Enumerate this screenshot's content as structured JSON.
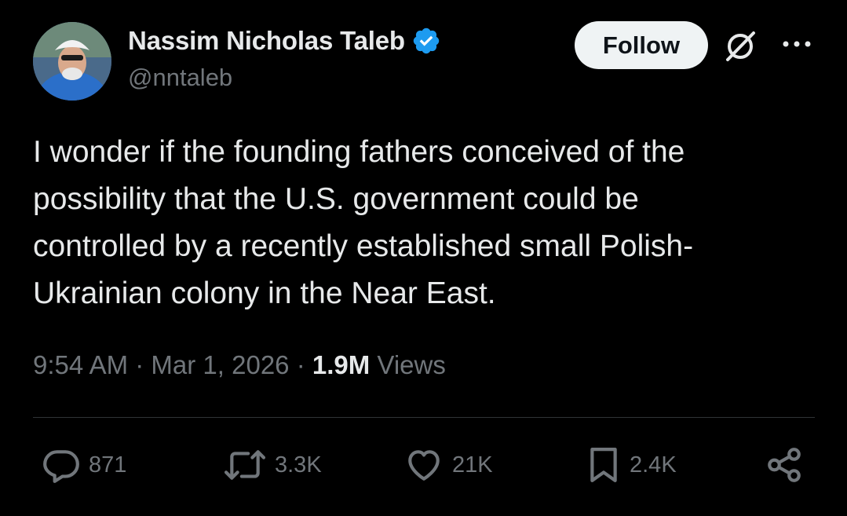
{
  "author": {
    "display_name": "Nassim Nicholas Taleb",
    "handle": "@nntaleb",
    "verified": true,
    "avatar_icon": "profile-photo"
  },
  "header_actions": {
    "follow_label": "Follow",
    "grok_icon": "grok-icon",
    "more_icon": "more-dots-icon"
  },
  "tweet": {
    "text_lines": [
      "I wonder if the founding fathers conceived of the",
      "possibility that the U.S. government could be",
      "controlled by a recently established small Polish-",
      "Ukrainian colony in the Near East."
    ],
    "time": "9:54 AM",
    "date": "Mar 1, 2026",
    "views_count": "1.9M",
    "views_label": "Views",
    "separator": "·"
  },
  "actions": {
    "replies": "871",
    "reposts": "3.3K",
    "likes": "21K",
    "bookmarks": "2.4K",
    "share_icon": "share-icon"
  },
  "colors": {
    "background": "#000000",
    "text_primary": "#e7e9ea",
    "text_secondary": "#71767b",
    "verified_blue": "#1d9bf0",
    "follow_bg": "#eff3f4",
    "divider": "#2f3336"
  }
}
